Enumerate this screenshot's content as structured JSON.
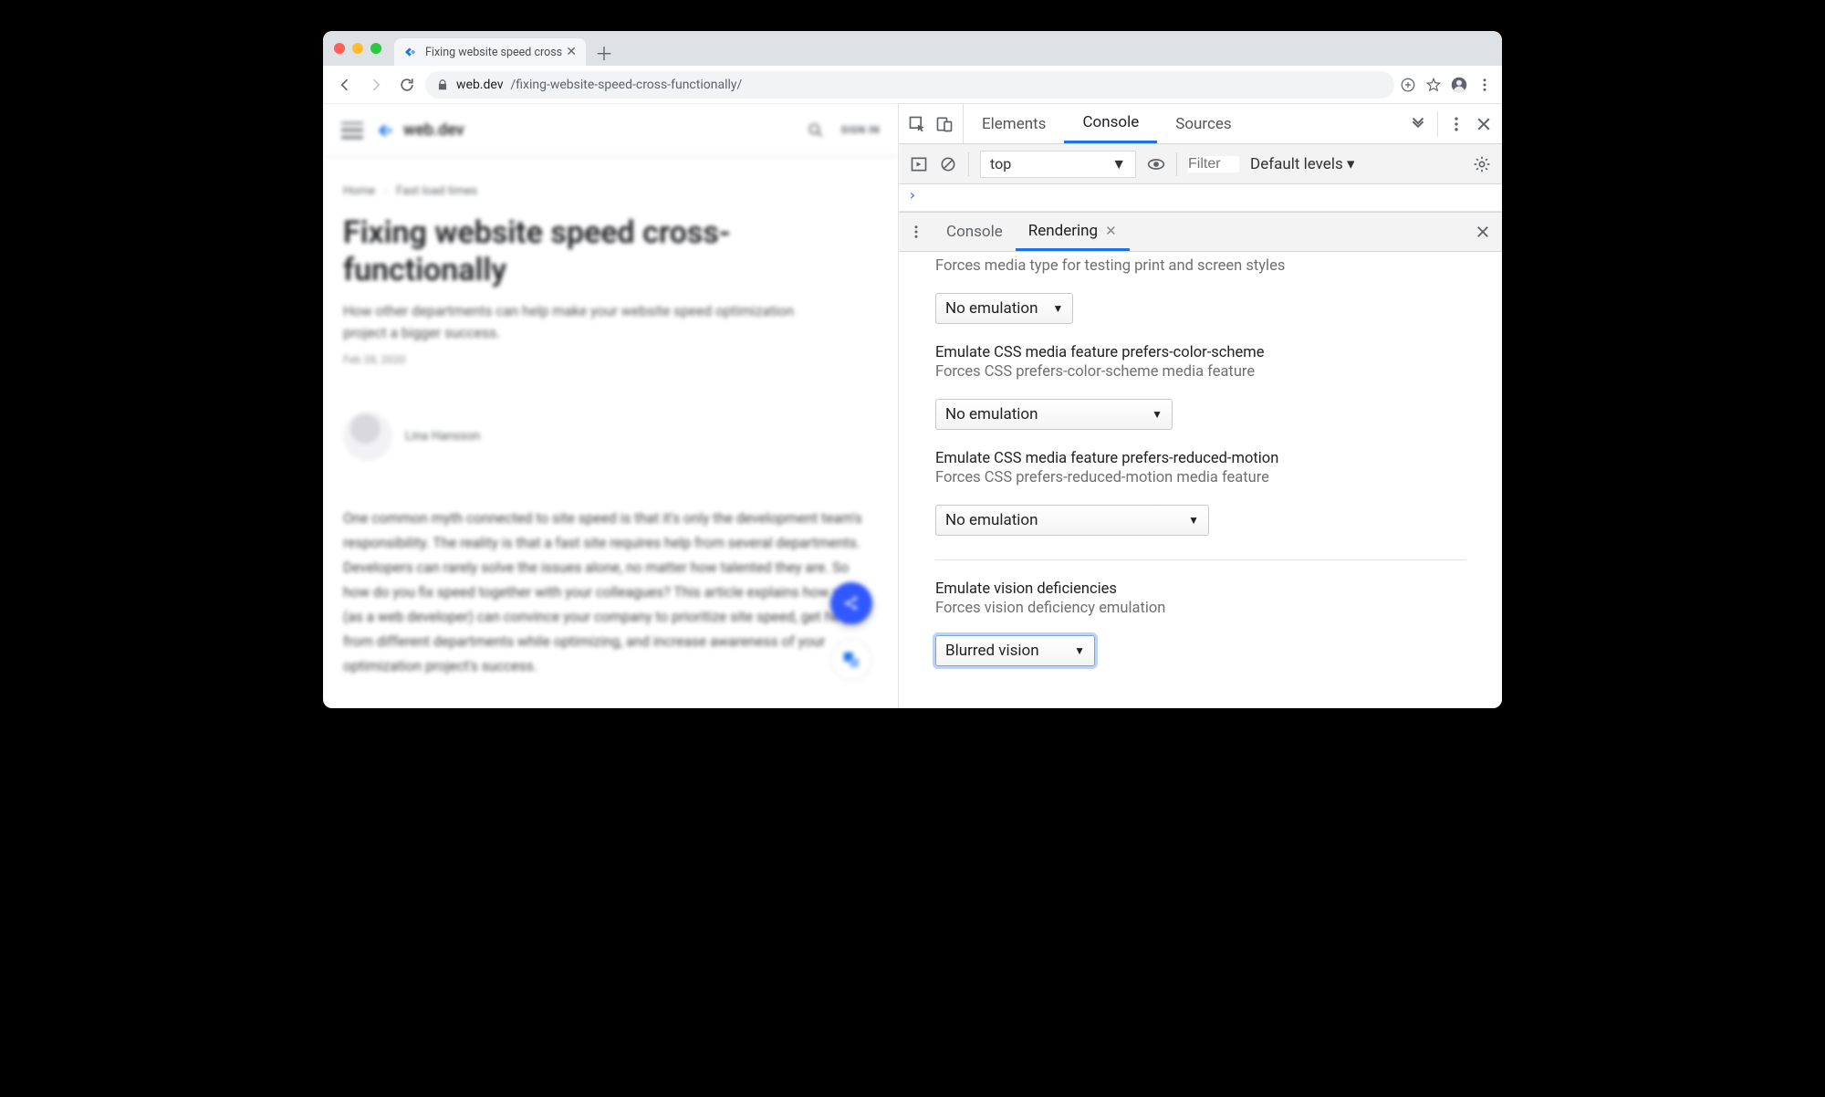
{
  "browser": {
    "tab_title": "Fixing website speed cross-fun",
    "url_domain": "web.dev",
    "url_path": "/fixing-website-speed-cross-functionally/"
  },
  "page": {
    "brand": "web.dev",
    "sign_in": "SIGN IN",
    "crumb_home": "Home",
    "crumb_section": "Fast load times",
    "title": "Fixing website speed cross-functionally",
    "subtitle": "How other departments can help make your website speed optimization project a bigger success.",
    "date": "Feb 28, 2020",
    "author": "Lina Hansson",
    "body": "One common myth connected to site speed is that it's only the development team's responsibility. The reality is that a fast site requires help from several departments. Developers can rarely solve the issues alone, no matter how talented they are. So how do you fix speed together with your colleagues? This article explains how you (as a web developer) can convince your company to prioritize site speed, get help from different departments while optimizing, and increase awareness of your optimization project's success."
  },
  "devtools": {
    "tabs": {
      "elements": "Elements",
      "console": "Console",
      "sources": "Sources"
    },
    "toolbar": {
      "context": "top",
      "filter_placeholder": "Filter",
      "levels": "Default levels"
    },
    "drawer": {
      "console": "Console",
      "rendering": "Rendering"
    },
    "rendering": {
      "media_desc": "Forces media type for testing print and screen styles",
      "media_value": "No emulation",
      "pcs_title": "Emulate CSS media feature prefers-color-scheme",
      "pcs_desc": "Forces CSS prefers-color-scheme media feature",
      "pcs_value": "No emulation",
      "prm_title": "Emulate CSS media feature prefers-reduced-motion",
      "prm_desc": "Forces CSS prefers-reduced-motion media feature",
      "prm_value": "No emulation",
      "vision_title": "Emulate vision deficiencies",
      "vision_desc": "Forces vision deficiency emulation",
      "vision_value": "Blurred vision"
    }
  }
}
